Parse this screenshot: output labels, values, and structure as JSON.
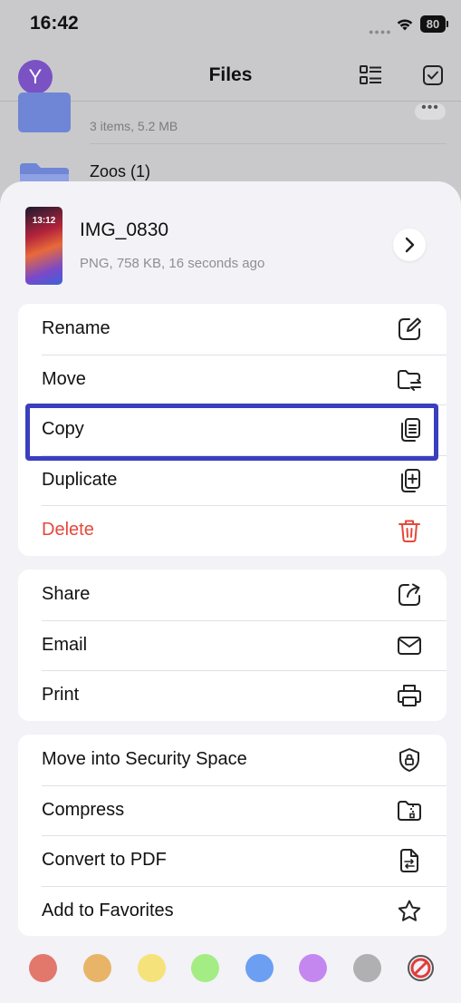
{
  "status_bar": {
    "time": "16:42",
    "battery": "80"
  },
  "nav": {
    "avatar_letter": "Y",
    "title": "Files"
  },
  "background_rows": [
    {
      "meta": "3 items, 5.2 MB"
    },
    {
      "name": "Zoos (1)"
    }
  ],
  "more_label": "•••",
  "sheet": {
    "file": {
      "thumb_time": "13:12",
      "name": "IMG_0830",
      "details": "PNG, 758 KB, 16 seconds ago"
    },
    "group1": [
      {
        "label": "Rename",
        "icon": "edit-icon"
      },
      {
        "label": "Move",
        "icon": "move-folder-icon"
      },
      {
        "label": "Copy",
        "icon": "copy-icon"
      },
      {
        "label": "Duplicate",
        "icon": "duplicate-icon"
      },
      {
        "label": "Delete",
        "icon": "trash-icon"
      }
    ],
    "group2": [
      {
        "label": "Share",
        "icon": "share-icon"
      },
      {
        "label": "Email",
        "icon": "mail-icon"
      },
      {
        "label": "Print",
        "icon": "printer-icon"
      }
    ],
    "group3": [
      {
        "label": "Move into Security Space",
        "icon": "shield-lock-icon"
      },
      {
        "label": "Compress",
        "icon": "zip-folder-icon"
      },
      {
        "label": "Convert to PDF",
        "icon": "pdf-convert-icon"
      },
      {
        "label": "Add to Favorites",
        "icon": "star-icon"
      }
    ],
    "colors": {
      "danger": "#e5483b",
      "highlight_border": "#3a3fbf",
      "tags": [
        "#e2786b",
        "#e8b467",
        "#f5e27a",
        "#a4ec84",
        "#6c9ff2",
        "#c487f0",
        "#b0b0b3"
      ],
      "no_tag": "#e23b3b"
    }
  }
}
